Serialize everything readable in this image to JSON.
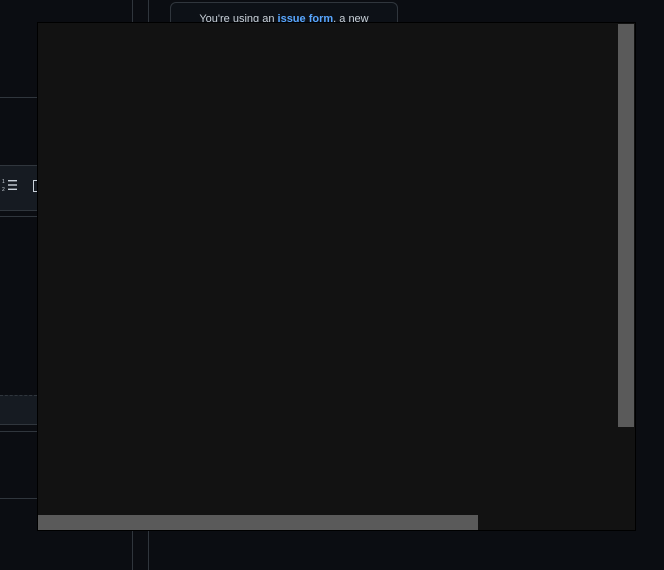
{
  "notice": {
    "prefix": "You're using an ",
    "link": "issue form",
    "suffix": ", a new"
  },
  "colors": {
    "background": "#0b0d12",
    "overlay": "#121212",
    "scrollbar": "#5a5a5a",
    "link": "#58a6ff"
  },
  "icons": {
    "ordered_list": "ordered-list-icon",
    "bracket": "bracket-icon"
  }
}
